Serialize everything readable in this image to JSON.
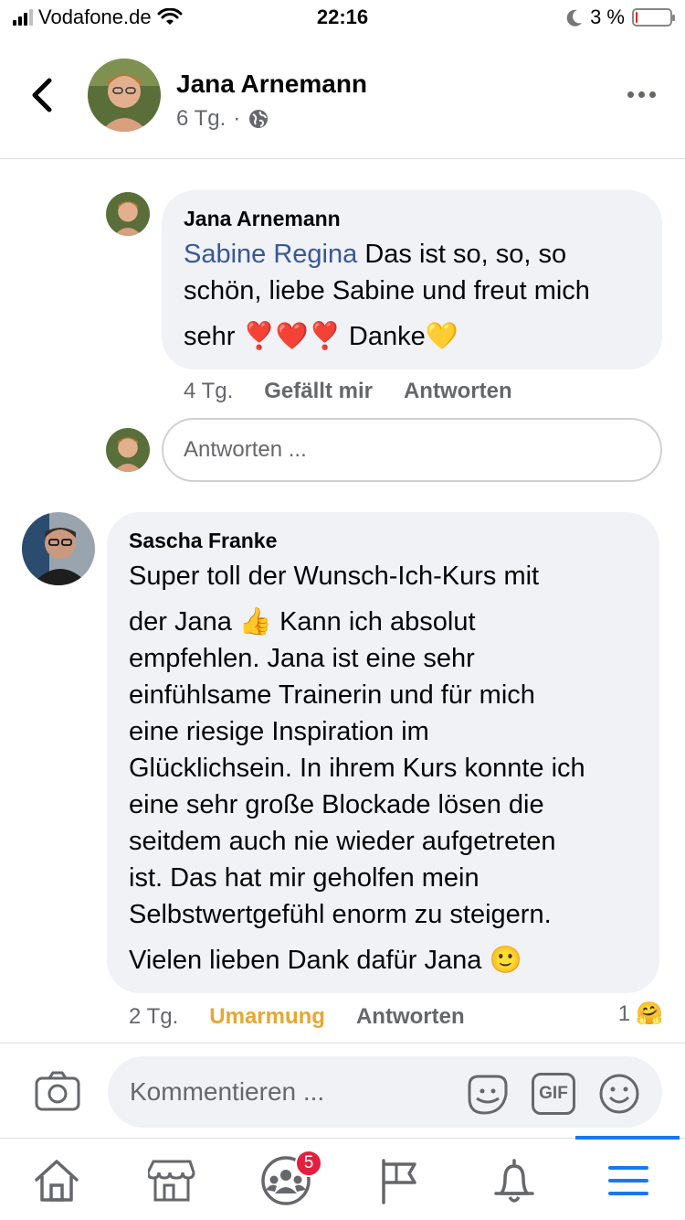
{
  "status_bar": {
    "carrier": "Vodafone.de",
    "time": "22:16",
    "battery_percent": "3 %",
    "battery_level": 0.03
  },
  "header": {
    "name": "Jana Arnemann",
    "age": "6 Tg.",
    "separator": "·",
    "privacy_icon": "globe-icon"
  },
  "comments": [
    {
      "author": "Jana Arnemann",
      "mention": "Sabine Regina",
      "line1": "Das ist so, so, so",
      "line2": "schön, liebe Sabine und freut mich",
      "line3_prefix": "sehr",
      "line3_emojis": "❣️❤️❣️",
      "line3_suffix": "Danke",
      "line3_end_emoji": "💛",
      "time": "4 Tg.",
      "like": "Gefällt mir",
      "reply": "Antworten"
    },
    {
      "author": "Sascha Franke",
      "lines": [
        "Super toll der Wunsch-Ich-Kurs mit",
        "der Jana 👍 Kann ich absolut",
        "empfehlen. Jana ist eine sehr",
        "einfühlsame Trainerin und für mich",
        "eine riesige Inspiration im",
        "Glücklichsein. In ihrem Kurs konnte ich",
        "eine sehr große Blockade lösen die",
        "seitdem auch nie wieder aufgetreten",
        "ist. Das hat mir geholfen mein",
        "Selbstwertgefühl enorm zu steigern.",
        "Vielen lieben Dank dafür Jana 🙂"
      ],
      "time": "2 Tg.",
      "reaction": "Umarmung",
      "reaction_color": "#e6a732",
      "reply": "Antworten",
      "reaction_count": "1",
      "reaction_emoji": "🤗"
    }
  ],
  "reply_input": {
    "placeholder": "Antworten ..."
  },
  "composer": {
    "placeholder": "Kommentieren ...",
    "gif_label": "GIF"
  },
  "nav": {
    "groups_badge": "5",
    "active_color": "#1877f2"
  }
}
